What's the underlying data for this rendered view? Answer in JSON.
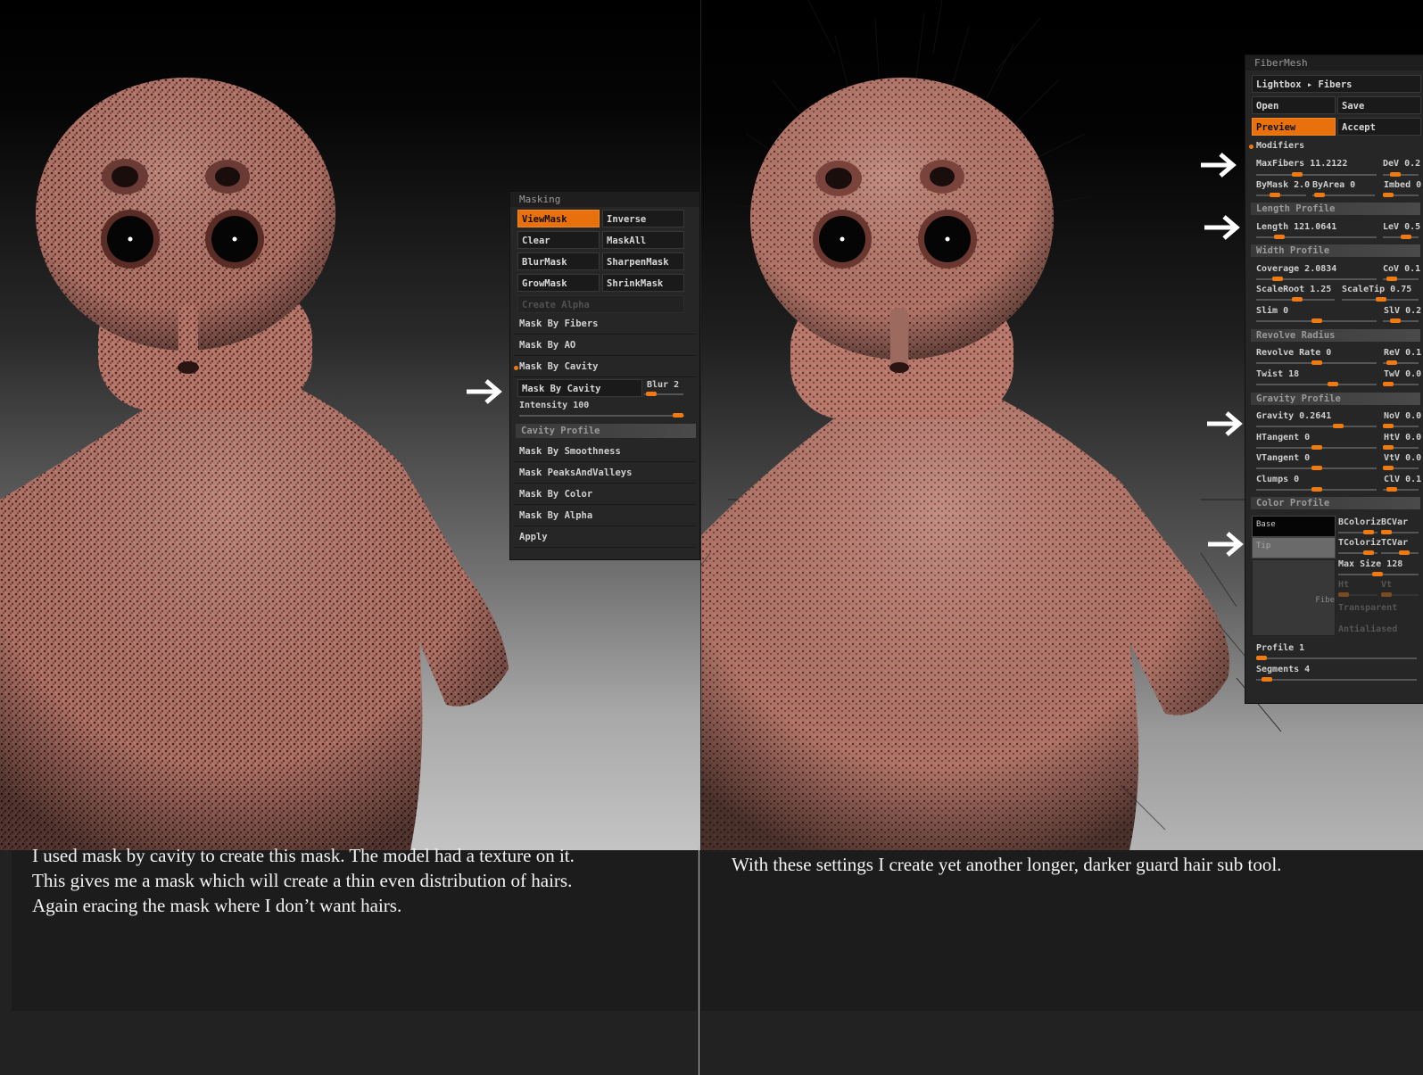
{
  "left_caption": "I used mask by cavity to create this mask. The model had a texture on it.\nThis gives me a mask which will create a thin even distribution of hairs.\nAgain eracing the mask where I don’t want hairs.",
  "right_caption": "With these settings I create yet another longer, darker guard hair sub tool.",
  "masking": {
    "title": "Masking",
    "view_mask": "ViewMask",
    "inverse": "Inverse",
    "clear": "Clear",
    "mask_all": "MaskAll",
    "blur_mask": "BlurMask",
    "sharpen_mask": "SharpenMask",
    "grow_mask": "GrowMask",
    "shrink_mask": "ShrinkMask",
    "create_alpha": "Create Alpha",
    "mask_by_fibers": "Mask By Fibers",
    "mask_by_ao": "Mask By AO",
    "mask_by_cavity": "Mask By Cavity",
    "mask_by_cavity_btn": "Mask By Cavity",
    "blur": "Blur 2",
    "intensity": "Intensity 100",
    "cavity_profile": "Cavity Profile",
    "mask_by_smoothness": "Mask By Smoothness",
    "mask_peaks_valleys": "Mask PeaksAndValleys",
    "mask_by_color": "Mask By Color",
    "mask_by_alpha": "Mask By Alpha",
    "apply": "Apply"
  },
  "fibermesh": {
    "title": "FiberMesh",
    "lightbox": "Lightbox ▸ Fibers",
    "open": "Open",
    "save": "Save",
    "preview": "Preview",
    "accept": "Accept",
    "modifiers": "Modifiers",
    "max_fibers": "MaxFibers 11.2122",
    "dev": "DeV 0.2",
    "bymask": "ByMask 2.0",
    "byarea": "ByArea 0",
    "imbed": "Imbed 0",
    "length_profile": "Length Profile",
    "length": "Length 121.0641",
    "lev": "LeV 0.5",
    "width_profile": "Width Profile",
    "coverage": "Coverage 2.0834",
    "cov": "CoV 0.1",
    "scale_root": "ScaleRoot 1.25",
    "scale_tip": "ScaleTip 0.75",
    "slim": "Slim 0",
    "slv": "SlV 0.2",
    "revolve_radius": "Revolve Radius",
    "revolve_rate": "Revolve Rate 0",
    "rev": "ReV 0.1",
    "twist": "Twist 18",
    "twv": "TwV 0.0",
    "gravity_profile": "Gravity Profile",
    "gravity": "Gravity 0.2641",
    "nov": "NoV 0.0",
    "htangent": "HTangent 0",
    "htv": "HtV 0.0",
    "vtangent": "VTangent 0",
    "vtv": "VtV 0.0",
    "clumps": "Clumps 0",
    "clv": "ClV 0.1",
    "color_profile": "Color Profile",
    "base": "Base",
    "tip": "Tip",
    "bcolorize": "BColoriz",
    "bcvar": "BCVar",
    "tcolorize": "TColoriz",
    "tcvar": "TCVar",
    "max_size": "Max Size 128",
    "ht": "Ht",
    "vt": "Vt",
    "fibe": "Fibe",
    "transparent": "Transparent",
    "antialiased": "Antialiased",
    "profile": "Profile 1",
    "segments": "Segments 4"
  },
  "colors": {
    "accent": "#e8710d",
    "panel": "#262626",
    "skin": "#b9786c"
  }
}
